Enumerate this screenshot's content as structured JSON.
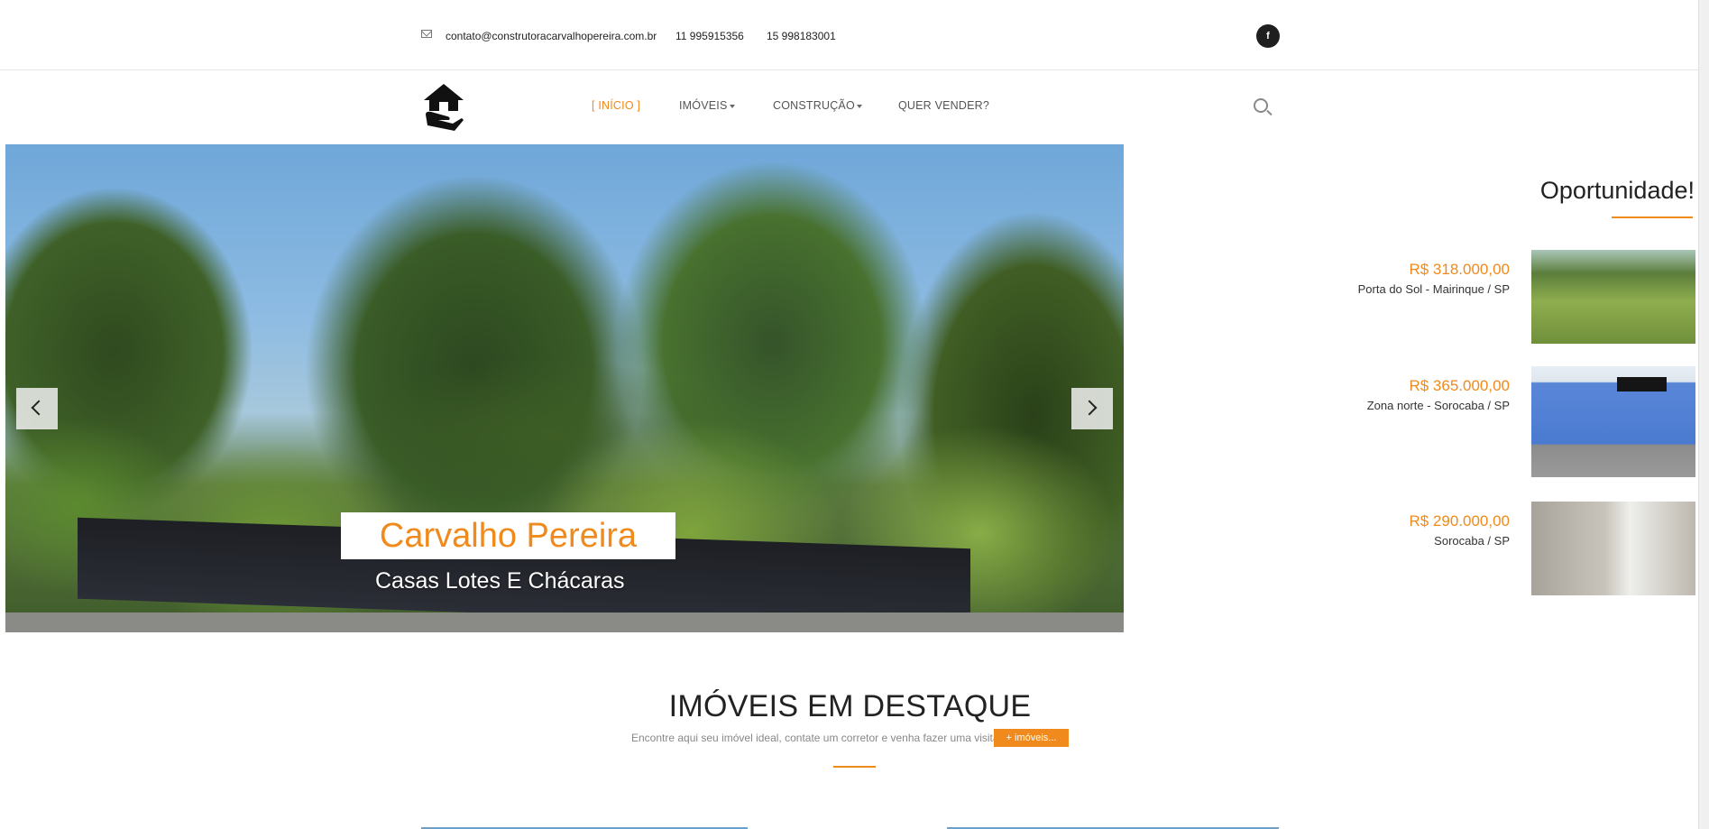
{
  "topbar": {
    "email": "contato@construtoracarvalhopereira.com.br",
    "phone1": "11 995915356",
    "phone2": "15 998183001",
    "facebook_label": "f"
  },
  "nav": {
    "items": [
      {
        "label": "[  INÍCIO  ]",
        "active": true
      },
      {
        "label": "IMÓVEIS",
        "dropdown": true
      },
      {
        "label": "CONSTRUÇÃO",
        "dropdown": true
      },
      {
        "label": "QUER VENDER?"
      }
    ]
  },
  "slider": {
    "title": "Carvalho Pereira",
    "subtitle": "Casas Lotes E Chácaras"
  },
  "oportunidade": {
    "title": "Oportunidade!",
    "items": [
      {
        "price": "R$ 318.000,00",
        "location": "Porta do Sol - Mairinque / SP"
      },
      {
        "price": "R$ 365.000,00",
        "location": "Zona norte - Sorocaba / SP"
      },
      {
        "price": "R$ 290.000,00",
        "location": "Sorocaba / SP"
      }
    ]
  },
  "destaque": {
    "title": "IMÓVEIS EM DESTAQUE",
    "subtitle": "Encontre aqui seu imóvel ideal, contate um corretor e venha fazer uma visita.",
    "button": "+ imóveis..."
  },
  "colors": {
    "accent": "#f08a1c",
    "text": "#222222"
  }
}
